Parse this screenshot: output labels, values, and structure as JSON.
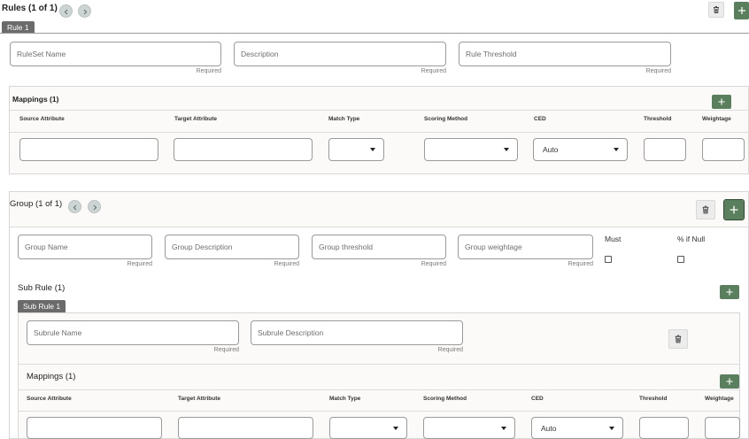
{
  "rules": {
    "title": "Rules (1 of 1)",
    "tab": "Rule 1",
    "fields": [
      {
        "placeholder": "RuleSet Name",
        "hint": "Required"
      },
      {
        "placeholder": "Description",
        "hint": "Required"
      },
      {
        "placeholder": "Rule Threshold",
        "hint": "Required"
      }
    ],
    "mappings": {
      "title": "Mappings (1)",
      "columns": [
        "Source Attribute",
        "Target Attribute",
        "Match Type",
        "Scoring Method",
        "CED",
        "Threshold",
        "Weightage"
      ],
      "ced_value": "Auto"
    }
  },
  "group": {
    "title": "Group (1 of 1)",
    "fields": [
      {
        "placeholder": "Group Name",
        "hint": "Required"
      },
      {
        "placeholder": "Group Description",
        "hint": "Required"
      },
      {
        "placeholder": "Group threshold",
        "hint": "Required"
      },
      {
        "placeholder": "Group weightage",
        "hint": "Required"
      }
    ],
    "must_label": "Must",
    "null_label": "% if Null",
    "subrule": {
      "title": "Sub Rule (1)",
      "tab": "Sub Rule 1",
      "fields": [
        {
          "placeholder": "Subrule Name",
          "hint": "Required"
        },
        {
          "placeholder": "Subrule Description",
          "hint": "Required"
        }
      ],
      "mappings": {
        "title": "Mappings (1)",
        "columns": [
          "Source Attribute",
          "Target Attribute",
          "Match Type",
          "Scoring Method",
          "CED",
          "Threshold",
          "Weightage"
        ],
        "ced_value": "Auto"
      }
    }
  },
  "icons": {
    "prev": "chevron-left-icon",
    "next": "chevron-right-icon",
    "delete": "trash-icon",
    "add": "plus-icon"
  },
  "colors": {
    "add_button": "#5a7f5c",
    "tab": "#6b6b6b",
    "nav_circle": "#cdd4d4"
  }
}
